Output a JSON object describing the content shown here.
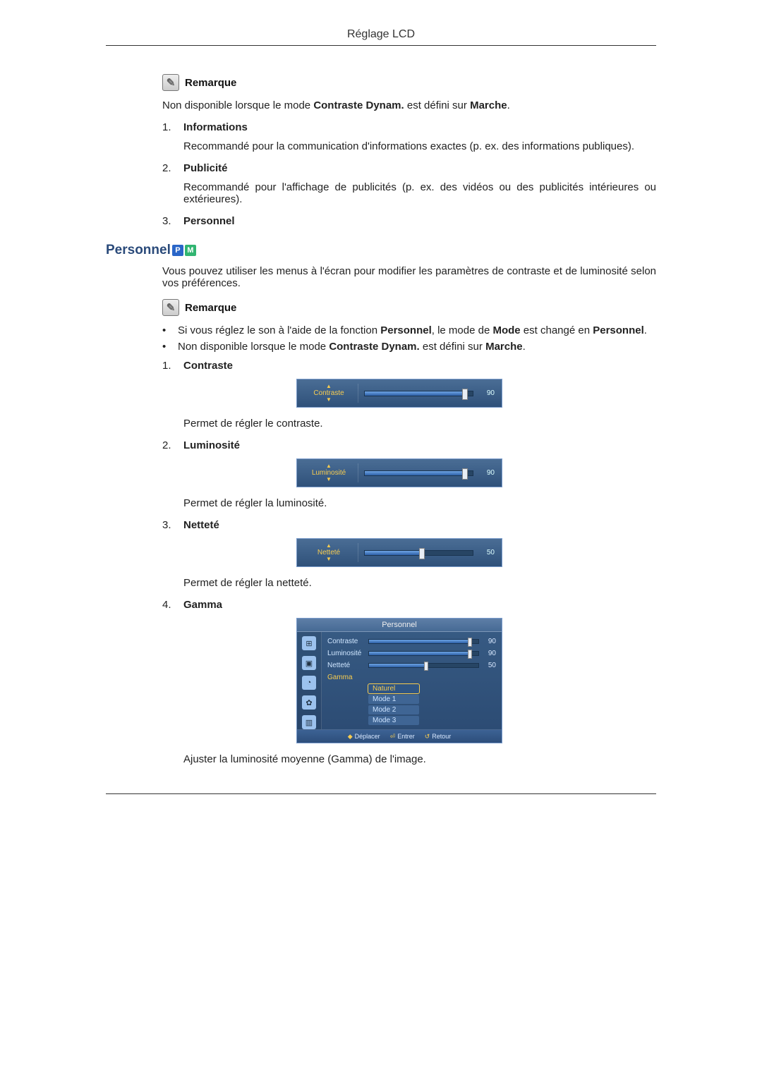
{
  "header": "Réglage LCD",
  "top_remark": {
    "label": "Remarque",
    "text_pre": "Non disponible lorsque le mode ",
    "kw1": "Contraste Dynam.",
    "text_mid": " est défini sur ",
    "kw2": "Marche",
    "text_post": "."
  },
  "modes": [
    {
      "n": "1.",
      "title": "Informations",
      "desc": "Recommandé pour la communication d'informations exactes (p. ex. des informations publiques)."
    },
    {
      "n": "2.",
      "title": "Publicité",
      "desc": "Recommandé pour l'affichage de publicités (p. ex. des vidéos ou des publicités intérieures ou extérieures)."
    },
    {
      "n": "3.",
      "title": "Personnel",
      "desc": ""
    }
  ],
  "personnel": {
    "heading": "Personnel",
    "intro": "Vous pouvez utiliser les menus à l'écran pour modifier les paramètres de contraste et de luminosité selon vos préférences.",
    "remark_label": "Remarque",
    "bullets": [
      {
        "pre": "Si vous réglez le son à l'aide de la fonction ",
        "kw1": "Personnel",
        "mid1": ", le mode de ",
        "kw2": "Mode",
        "mid2": " est changé en ",
        "kw3": "Personnel",
        "post": "."
      },
      {
        "pre": "Non disponible lorsque le mode ",
        "kw1": "Contraste Dynam.",
        "mid1": " est défini sur ",
        "kw2": "Marche",
        "post": "."
      }
    ],
    "items": [
      {
        "n": "1.",
        "title": "Contraste",
        "osd_label": "Contraste",
        "value": 90,
        "desc": "Permet de régler le contraste."
      },
      {
        "n": "2.",
        "title": "Luminosité",
        "osd_label": "Luminosité",
        "value": 90,
        "desc": "Permet de régler la luminosité."
      },
      {
        "n": "3.",
        "title": "Netteté",
        "osd_label": "Netteté",
        "value": 50,
        "desc": "Permet de régler la netteté."
      },
      {
        "n": "4.",
        "title": "Gamma",
        "desc": "Ajuster la luminosité moyenne (Gamma) de l'image."
      }
    ]
  },
  "gamma_menu": {
    "title": "Personnel",
    "rows": [
      {
        "label": "Contraste",
        "value": 90
      },
      {
        "label": "Luminosité",
        "value": 90
      },
      {
        "label": "Netteté",
        "value": 50
      }
    ],
    "gamma_label": "Gamma",
    "options": [
      "Naturel",
      "Mode 1",
      "Mode 2",
      "Mode 3"
    ],
    "selected": "Naturel",
    "footer": {
      "move": "Déplacer",
      "enter": "Entrer",
      "back": "Retour"
    }
  }
}
